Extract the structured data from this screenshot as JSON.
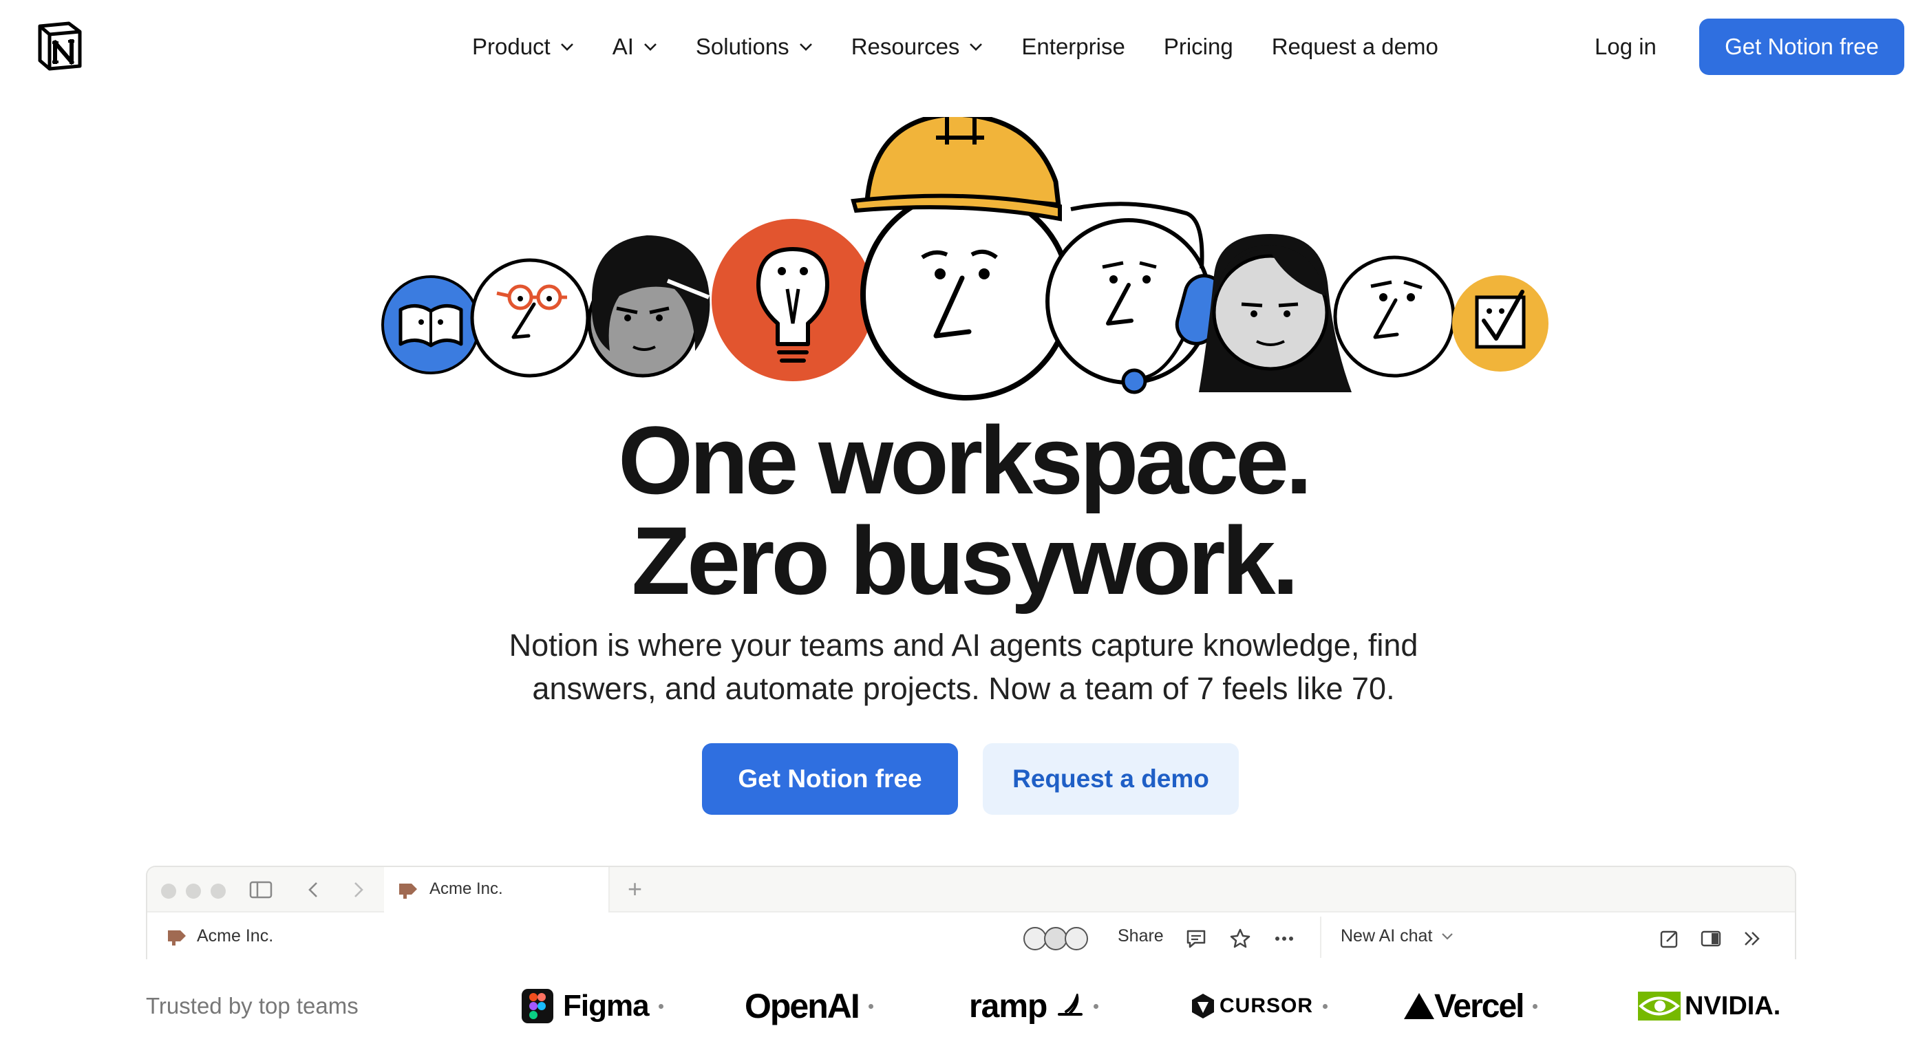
{
  "nav": {
    "items": [
      {
        "label": "Product",
        "dropdown": true
      },
      {
        "label": "AI",
        "dropdown": true
      },
      {
        "label": "Solutions",
        "dropdown": true
      },
      {
        "label": "Resources",
        "dropdown": true
      },
      {
        "label": "Enterprise",
        "dropdown": false
      },
      {
        "label": "Pricing",
        "dropdown": false
      },
      {
        "label": "Request a demo",
        "dropdown": false
      }
    ],
    "login": "Log in",
    "cta": "Get Notion free"
  },
  "hero": {
    "headline_line1": "One workspace.",
    "headline_line2": "Zero busywork.",
    "subhead_line1": "Notion is where your teams and AI agents capture knowledge, find",
    "subhead_line2": "answers, and automate projects. Now a team of 7 feels like 70.",
    "cta_primary": "Get Notion free",
    "cta_secondary": "Request a demo"
  },
  "preview": {
    "tab_label": "Acme Inc.",
    "breadcrumb": "Acme Inc.",
    "share": "Share",
    "new_ai_chat": "New AI chat"
  },
  "trusted": {
    "label": "Trusted by top teams",
    "brands": [
      "Figma",
      "OpenAI",
      "ramp",
      "CURSOR",
      "Vercel",
      "NVIDIA."
    ]
  },
  "colors": {
    "primary": "#2f6fe0",
    "secondary_bg": "#e9f2fd",
    "secondary_text": "#1f5fc6",
    "blue": "#3b7ce0",
    "orange_red": "#e2552f",
    "yellow": "#f1b43a"
  }
}
